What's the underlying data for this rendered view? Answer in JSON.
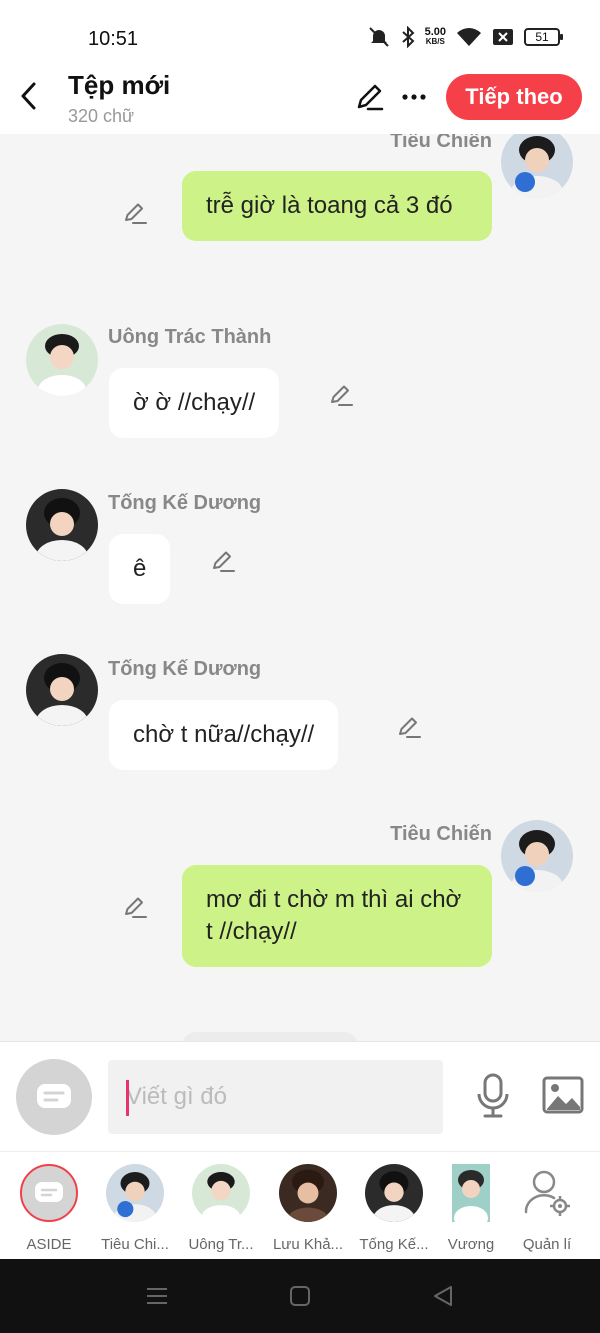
{
  "status_bar": {
    "time": "10:51",
    "net_speed_value": "5.00",
    "net_speed_unit": "KB/S",
    "battery": "51"
  },
  "header": {
    "title": "Tệp mới",
    "subtitle": "320 chữ",
    "next_label": "Tiếp theo"
  },
  "messages": [
    {
      "sender": "Tiêu Chiến",
      "text": "trễ giờ là toang cả 3 đó",
      "side": "right"
    },
    {
      "sender": "Uông Trác Thành",
      "text": "ờ ờ //chạy//",
      "side": "left"
    },
    {
      "sender": "Tống Kế Dương",
      "text": "ê",
      "side": "left"
    },
    {
      "sender": "Tống Kế Dương",
      "text": "chờ t nữa//chạy//",
      "side": "left"
    },
    {
      "sender": "Tiêu Chiến",
      "text": "mơ đi t chờ m thì ai chờ t //chạy//",
      "side": "right"
    }
  ],
  "composer": {
    "placeholder": "Viết gì đó"
  },
  "characters": [
    {
      "name": "ASIDE"
    },
    {
      "name": "Tiêu Chi..."
    },
    {
      "name": "Uông Tr..."
    },
    {
      "name": "Lưu Khả..."
    },
    {
      "name": "Tống Kế..."
    },
    {
      "name": "Vương"
    },
    {
      "name": "Quản lí"
    }
  ],
  "colors": {
    "accent": "#f5404a",
    "bubble_right": "#cdf287",
    "bubble_left": "#ffffff",
    "caret": "#e8336b"
  }
}
